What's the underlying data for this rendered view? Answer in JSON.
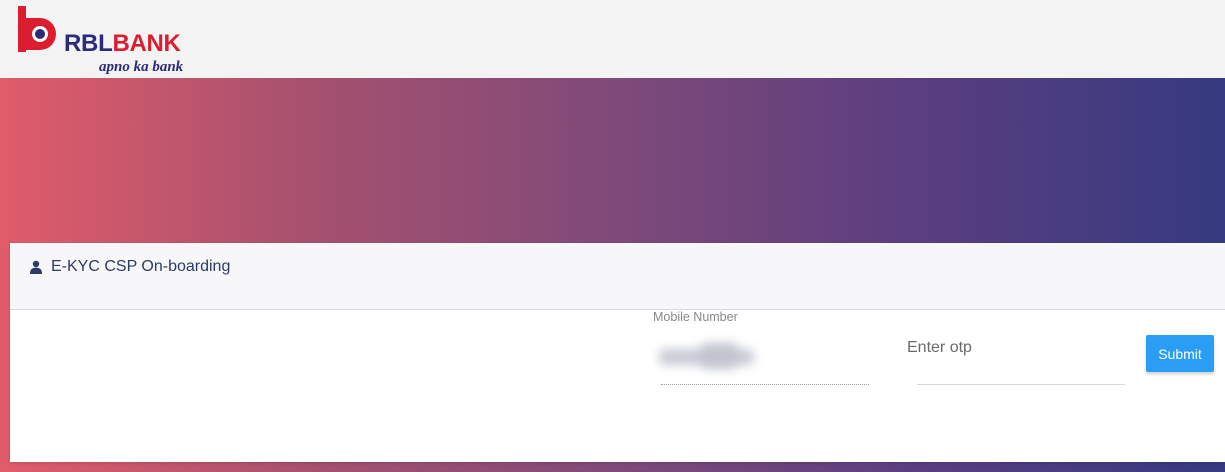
{
  "header": {
    "logo": {
      "mark_icon": "rbl-logo-mark",
      "brand_part1": "RBL",
      "brand_part2": "BANK",
      "tagline": "apno ka bank",
      "colors": {
        "navy": "#2b2b77",
        "red": "#d91f2f"
      }
    }
  },
  "banner": {
    "gradient": [
      "#e05c6a",
      "#363a80"
    ]
  },
  "card": {
    "title_icon": "user-icon",
    "title": "E-KYC CSP On-boarding",
    "form": {
      "mobile": {
        "label": "Mobile Number",
        "value": "",
        "blurred": true
      },
      "otp": {
        "placeholder": "Enter otp",
        "value": ""
      },
      "submit_label": "Submit",
      "submit_color": "#2a9df4"
    }
  }
}
